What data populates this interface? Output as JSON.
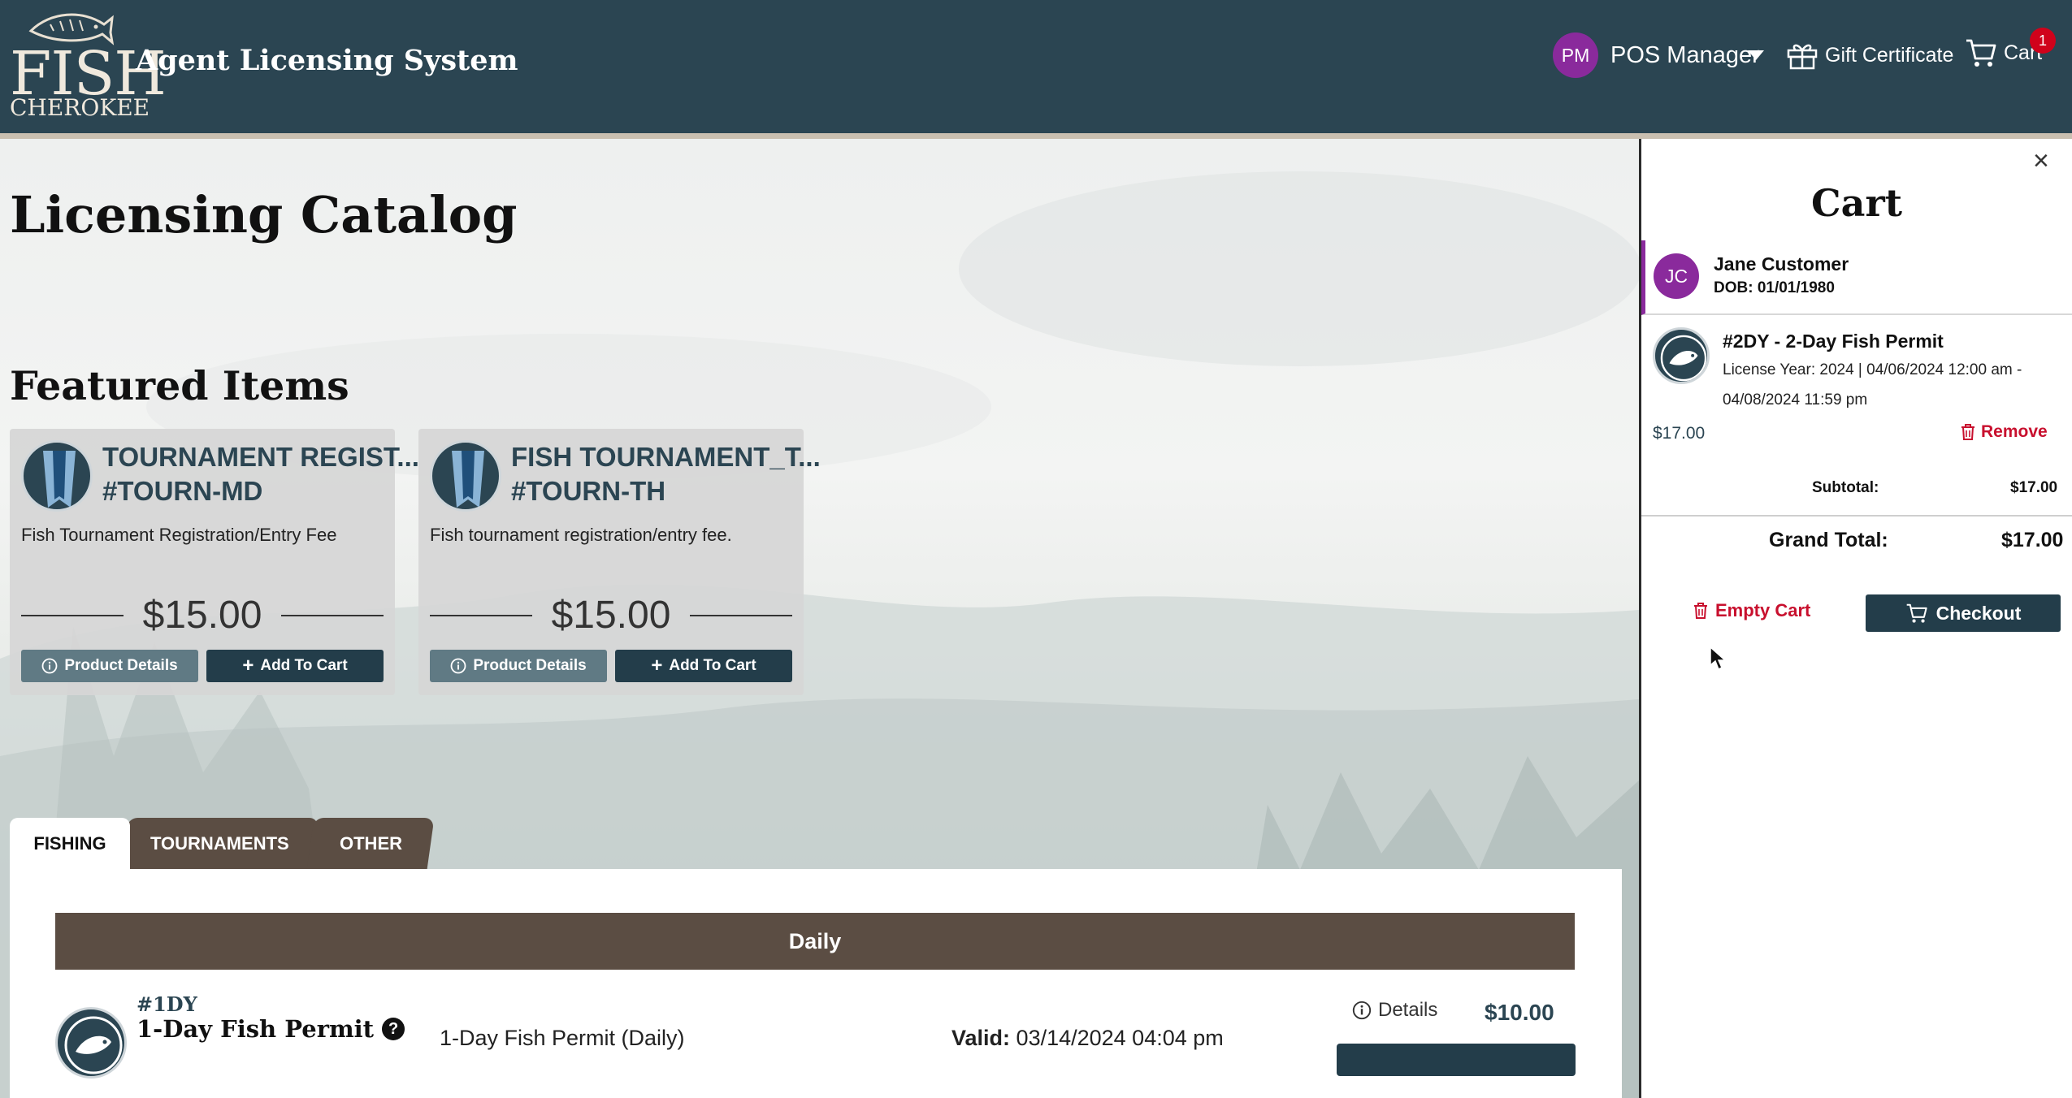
{
  "header": {
    "logo_text": "FISH",
    "logo_subtext": "CHEROKEE",
    "app_title": "Agent Licensing System",
    "user_initials": "PM",
    "user_name": "POS Manager",
    "gift_certificate_label": "Gift Certificate",
    "cart_label": "Cart",
    "cart_count": "1"
  },
  "main": {
    "page_title": "Licensing Catalog",
    "featured_title": "Featured Items",
    "featured_items": [
      {
        "name": "TOURNAMENT REGIST...",
        "code": "#TOURN-MD",
        "description": "Fish Tournament Registration/Entry Fee",
        "price": "$15.00",
        "details_label": "Product Details",
        "add_label": "Add To Cart"
      },
      {
        "name": "FISH TOURNAMENT_T...",
        "code": "#TOURN-TH",
        "description": "Fish tournament registration/entry fee.",
        "price": "$15.00",
        "details_label": "Product Details",
        "add_label": "Add To Cart"
      }
    ],
    "tabs": [
      {
        "label": "FISHING",
        "active": true
      },
      {
        "label": "TOURNAMENTS",
        "active": false
      },
      {
        "label": "OTHER",
        "active": false
      }
    ],
    "section_header": "Daily",
    "list_items": [
      {
        "code": "#1DY",
        "name": "1-Day Fish Permit",
        "help": "?",
        "description": "1-Day Fish Permit (Daily)",
        "valid_label": "Valid:",
        "valid_value": "03/14/2024 04:04 pm",
        "details_label": "Details",
        "price": "$10.00"
      }
    ]
  },
  "cart": {
    "close": "×",
    "title": "Cart",
    "customer": {
      "initials": "JC",
      "name": "Jane Customer",
      "dob": "DOB: 01/01/1980"
    },
    "item": {
      "name": "#2DY - 2-Day Fish Permit",
      "detail_line1": "License Year: 2024 | 04/06/2024 12:00 am -",
      "detail_line2": "04/08/2024 11:59 pm",
      "price": "$17.00",
      "remove_label": "Remove"
    },
    "subtotal_label": "Subtotal:",
    "subtotal_value": "$17.00",
    "grand_total_label": "Grand Total:",
    "grand_total_value": "$17.00",
    "empty_cart_label": "Empty Cart",
    "checkout_label": "Checkout"
  },
  "colors": {
    "header_bg": "#2b4552",
    "accent_dark": "#233d4a",
    "tab_brown": "#5b4d43",
    "avatar_purple": "#8a2a9c",
    "danger_red": "#c8102e",
    "badge_red": "#d0021b"
  },
  "icons": [
    "fish-logo-icon",
    "chevron-down-icon",
    "gift-icon",
    "cart-icon",
    "info-icon",
    "plus-icon",
    "trash-icon",
    "close-icon",
    "fish-badge-icon",
    "mouse-cursor-icon"
  ]
}
